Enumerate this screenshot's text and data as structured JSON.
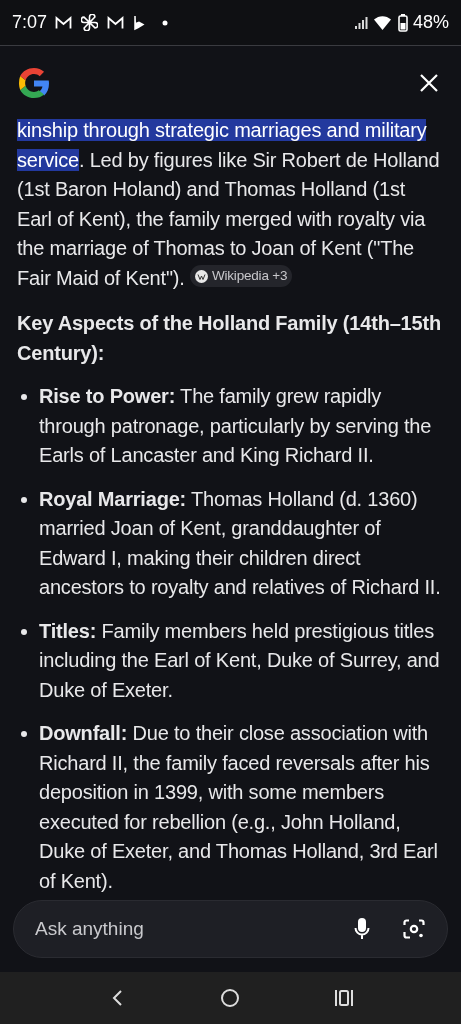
{
  "status_bar": {
    "time": "7:07",
    "battery": "48%"
  },
  "answer": {
    "intro": {
      "highlighted": "kinship through strategic marriages and military service",
      "text": ". Led by figures like Sir Robert de Holland (1st Baron Holand) and Thomas Holland (1st Earl of Kent), the family merged with royalty via the marriage of Thomas to Joan of Kent (\"The Fair Maid of Kent\").",
      "source_chip": "Wikipedia +3"
    },
    "heading": "Key Aspects of the Holland Family (14th–15th Century):",
    "bullets": [
      "**Rise to Power:** The family grew rapidly through patronage, particularly by serving the Earls of Lancaster and King Richard II.",
      "**Royal Marriage:** Thomas Holland (d. 1360) married Joan of Kent, granddaughter of Edward I, making their children direct ancestors to royalty and relatives of Richard II.",
      "**Titles:** Family members held prestigious titles including the Earl of Kent, Duke of Surrey, and Duke of Exeter.",
      "**Downfall:** Due to their close association with Richard II, the family faced reversals after his deposition in 1399, with some members executed for rebellion (e.g., John Holland, Duke of Exeter, and Thomas Holland, 3rd Earl of Kent)."
    ]
  },
  "ask_bar": {
    "placeholder": "Ask anything"
  }
}
